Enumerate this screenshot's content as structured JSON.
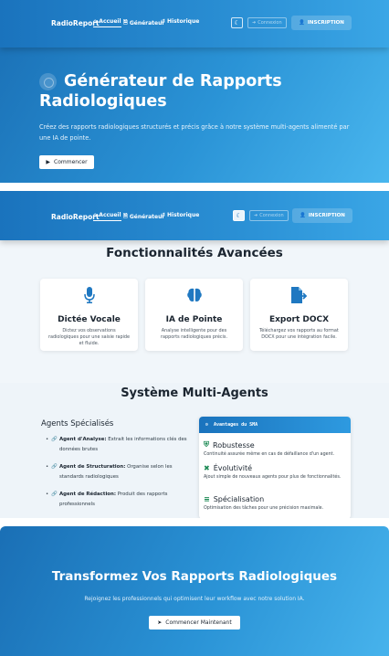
{
  "colors": {
    "primary": "#1a73bd",
    "accent": "#2a93d6",
    "success": "#1d8a55"
  },
  "nav": {
    "brand": "RadioReport",
    "links": [
      {
        "label": "Accueil",
        "icon": "home-icon",
        "active": true
      },
      {
        "label": "Générateur",
        "icon": "file-icon",
        "active": false
      },
      {
        "label": "Historique",
        "icon": "history-icon",
        "active": false
      }
    ],
    "theme_icon": "moon-icon",
    "login_label": "Connexion",
    "signup_label": "INSCRIPTION"
  },
  "hero": {
    "title": "Générateur de Rapports Radiologiques",
    "subtitle": "Créez des rapports radiologiques structurés et précis grâce à notre système multi-agents alimenté par une IA de pointe.",
    "cta_label": "Commencer"
  },
  "features": {
    "title": "Fonctionnalités Avancées",
    "cards": [
      {
        "icon": "microphone-icon",
        "title": "Dictée Vocale",
        "desc": "Dictez vos observations radiologiques pour une saisie rapide et fluide."
      },
      {
        "icon": "brain-icon",
        "title": "IA de Pointe",
        "desc": "Analyse intelligente pour des rapports radiologiques précis."
      },
      {
        "icon": "file-export-icon",
        "title": "Export DOCX",
        "desc": "Téléchargez vos rapports au format DOCX pour une intégration facile."
      }
    ]
  },
  "multi": {
    "title": "Système Multi-Agents",
    "agents_title": "Agents Spécialisés",
    "agents": [
      {
        "name": "Agent d'Analyse:",
        "desc": " Extrait les informations clés des données brutes"
      },
      {
        "name": "Agent de Structuration:",
        "desc": " Organise selon les standards radiologiques"
      },
      {
        "name": "Agent de Rédaction:",
        "desc": " Produit des rapports professionnels"
      }
    ],
    "sma_header": "Avantages du SMA",
    "advantages": [
      {
        "icon": "shield-icon",
        "title": "Robustesse",
        "desc": "Continuité assurée même en cas de défaillance d'un agent."
      },
      {
        "icon": "puzzle-icon",
        "title": "Évolutivité",
        "desc": "Ajout simple de nouveaux agents pour plus de fonctionnalités."
      },
      {
        "icon": "list-icon",
        "title": "Spécialisation",
        "desc": "Optimisation des tâches pour une précision maximale."
      }
    ]
  },
  "cta": {
    "title": "Transformez Vos Rapports Radiologiques",
    "subtitle": "Rejoignez les professionnels qui optimisent leur workflow avec notre solution IA.",
    "button_label": "Commencer Maintenant"
  }
}
